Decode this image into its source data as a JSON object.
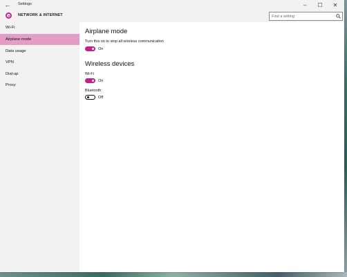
{
  "window": {
    "title": "Settings",
    "back_icon": "back-arrow-icon",
    "minimize_label": "–",
    "maximize_label": "☐",
    "close_label": "✕"
  },
  "header": {
    "title": "NETWORK & INTERNET",
    "icon": "gear-icon",
    "accent_color": "#c41f8a",
    "search": {
      "placeholder": "Find a setting",
      "value": "",
      "icon": "search-icon"
    }
  },
  "sidebar": {
    "selected_color": "#e49dc6",
    "items": [
      {
        "label": "Wi-Fi",
        "selected": false
      },
      {
        "label": "Airplane mode",
        "selected": true
      },
      {
        "label": "Data usage",
        "selected": false
      },
      {
        "label": "VPN",
        "selected": false
      },
      {
        "label": "Dial-up",
        "selected": false
      },
      {
        "label": "Proxy",
        "selected": false
      }
    ]
  },
  "main": {
    "airplane": {
      "heading": "Airplane mode",
      "description": "Turn this on to stop all wireless communication",
      "toggle_state": "On",
      "on": true
    },
    "wireless": {
      "heading": "Wireless devices",
      "wifi": {
        "label": "Wi-Fi",
        "toggle_state": "On",
        "on": true
      },
      "bluetooth": {
        "label": "Bluetooth",
        "toggle_state": "Off",
        "on": false
      }
    }
  }
}
